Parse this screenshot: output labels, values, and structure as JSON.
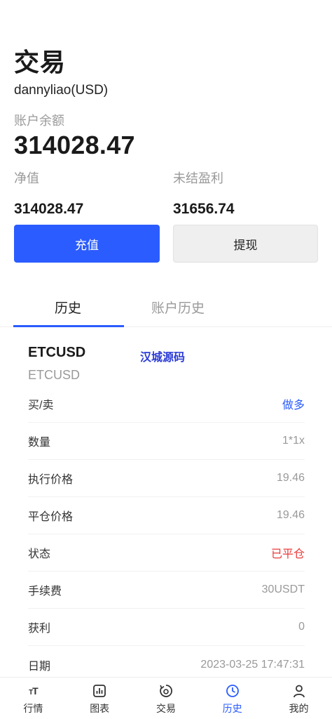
{
  "header": {
    "title": "交易",
    "account_name": "dannyliao(USD)",
    "balance_label": "账户余额",
    "balance_value": "314028.47"
  },
  "stats": {
    "equity_label": "净值",
    "equity_value": "314028.47",
    "pnl_label": "未结盈利",
    "pnl_value": "31656.74"
  },
  "actions": {
    "deposit_label": "充值",
    "withdraw_label": "提现"
  },
  "tabs": {
    "history": "历史",
    "account_history": "账户历史"
  },
  "order": {
    "symbol": "ETCUSD",
    "watermark": "汉城源码",
    "symbol_sub": "ETCUSD",
    "rows": [
      {
        "label": "买/卖",
        "value": "做多"
      },
      {
        "label": "数量",
        "value": "1*1x"
      },
      {
        "label": "执行价格",
        "value": "19.46"
      },
      {
        "label": "平仓价格",
        "value": "19.46"
      },
      {
        "label": "状态",
        "value": "已平仓"
      },
      {
        "label": "手续费",
        "value": "30USDT"
      },
      {
        "label": "获利",
        "value": "0"
      },
      {
        "label": "日期",
        "value": "2023-03-25 17:47:31"
      }
    ]
  },
  "nav": {
    "items": [
      {
        "label": "行情",
        "icon": "font-size-icon"
      },
      {
        "label": "图表",
        "icon": "chart-icon"
      },
      {
        "label": "交易",
        "icon": "trade-icon"
      },
      {
        "label": "历史",
        "icon": "clock-icon"
      },
      {
        "label": "我的",
        "icon": "user-icon"
      }
    ]
  },
  "colors": {
    "accent": "#2b5cff",
    "closed_status": "#e83b3b"
  }
}
